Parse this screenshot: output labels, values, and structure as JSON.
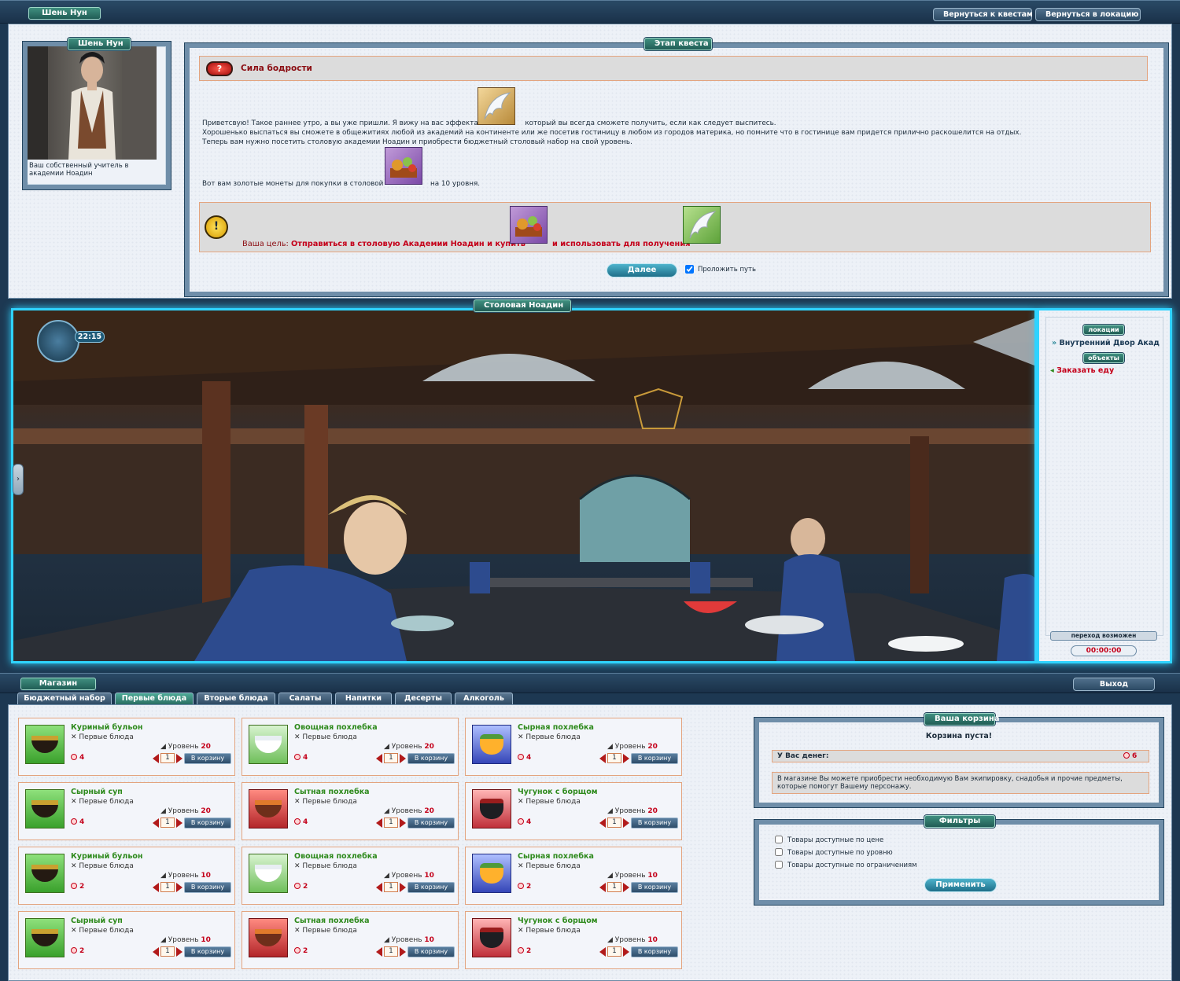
{
  "top": {
    "character_tag": "Шень Нун",
    "back_quests": "Вернуться к квестам",
    "back_location": "Вернуться в локацию"
  },
  "npc": {
    "name": "Шень Нун",
    "caption": "Ваш собственный учитель в академии Ноадин"
  },
  "quest": {
    "stage_tag": "Этап квеста",
    "title": "Сила бодрости",
    "p1_a": "Приветсвую! Такое раннее утро, а вы уже пришли. Я вижу на вас эффекта",
    "p1_b": "который вы всегда сможете получить, если как следует выспитесь.",
    "p2": "Хорошенько выспаться вы сможете в общежитиях любой из академий на континенте или же посетив гостиницу в любом из городов материка, но помните что в гостинице вам придется прилично раскошелится на отдых.",
    "p3": "Теперь вам нужно посетить столовую академии Ноадин и приобрести бюджетный столовый набор на свой уровень.",
    "p4_a": "Вот вам золотые монеты для покупки в столовой",
    "p4_b": "на 10 уровня.",
    "goal_label": "Ваша цель:",
    "goal_text_1": "Отправиться в столовую Академии Ноадин и купить",
    "goal_text_2": "и использовать для получения",
    "next_button": "Далее",
    "route_checkbox": "Проложить путь"
  },
  "location": {
    "title": "Столовая Ноадин",
    "time": "22:15",
    "locations_tag": "локации",
    "location_item": "Внутренний Двор Акад",
    "objects_tag": "объекты",
    "object_item": "Заказать еду",
    "transition_status": "переход возможен",
    "transition_timer": "00:00:00"
  },
  "shop": {
    "title": "Магазин",
    "exit": "Выход",
    "tabs": [
      "Бюджетный набор",
      "Первые блюда",
      "Вторые блюда",
      "Салаты",
      "Напитки",
      "Десерты",
      "Алкоголь"
    ],
    "active_tab": "Первые блюда",
    "level_label": "Уровень",
    "cart_button": "В корзину",
    "items": [
      {
        "name": "Куриный бульон",
        "category": "Первые блюда",
        "level": "20",
        "price": "4",
        "qty": "1",
        "kind": "chicken"
      },
      {
        "name": "Овощная похлебка",
        "category": "Первые блюда",
        "level": "20",
        "price": "4",
        "qty": "1",
        "kind": "vegetable"
      },
      {
        "name": "Сырная похлебка",
        "category": "Первые блюда",
        "level": "20",
        "price": "4",
        "qty": "1",
        "kind": "cheese"
      },
      {
        "name": "Сырный суп",
        "category": "Первые блюда",
        "level": "20",
        "price": "4",
        "qty": "1",
        "kind": "chicken"
      },
      {
        "name": "Сытная похлебка",
        "category": "Первые блюда",
        "level": "20",
        "price": "4",
        "qty": "1",
        "kind": "hearty"
      },
      {
        "name": "Чугунок с борщом",
        "category": "Первые блюда",
        "level": "20",
        "price": "4",
        "qty": "1",
        "kind": "borscht"
      },
      {
        "name": "Куриный бульон",
        "category": "Первые блюда",
        "level": "10",
        "price": "2",
        "qty": "1",
        "kind": "chicken"
      },
      {
        "name": "Овощная похлебка",
        "category": "Первые блюда",
        "level": "10",
        "price": "2",
        "qty": "1",
        "kind": "vegetable"
      },
      {
        "name": "Сырная похлебка",
        "category": "Первые блюда",
        "level": "10",
        "price": "2",
        "qty": "1",
        "kind": "cheese"
      },
      {
        "name": "Сырный суп",
        "category": "Первые блюда",
        "level": "10",
        "price": "2",
        "qty": "1",
        "kind": "chicken"
      },
      {
        "name": "Сытная похлебка",
        "category": "Первые блюда",
        "level": "10",
        "price": "2",
        "qty": "1",
        "kind": "hearty"
      },
      {
        "name": "Чугунок с борщом",
        "category": "Первые блюда",
        "level": "10",
        "price": "2",
        "qty": "1",
        "kind": "borscht"
      }
    ]
  },
  "cart": {
    "title": "Ваша корзина",
    "empty": "Корзина пуста!",
    "money_label": "У Вас денег:",
    "money_value": "6",
    "info": "В магазине Вы можете приобрести необходимую Вам экипировку, снадобья и прочие предметы, которые помогут Вашему персонажу."
  },
  "filters": {
    "title": "Фильтры",
    "options": [
      "Товары доступные по цене",
      "Товары доступные по уровню",
      "Товары доступные по ограничениям"
    ],
    "apply": "Применить"
  }
}
